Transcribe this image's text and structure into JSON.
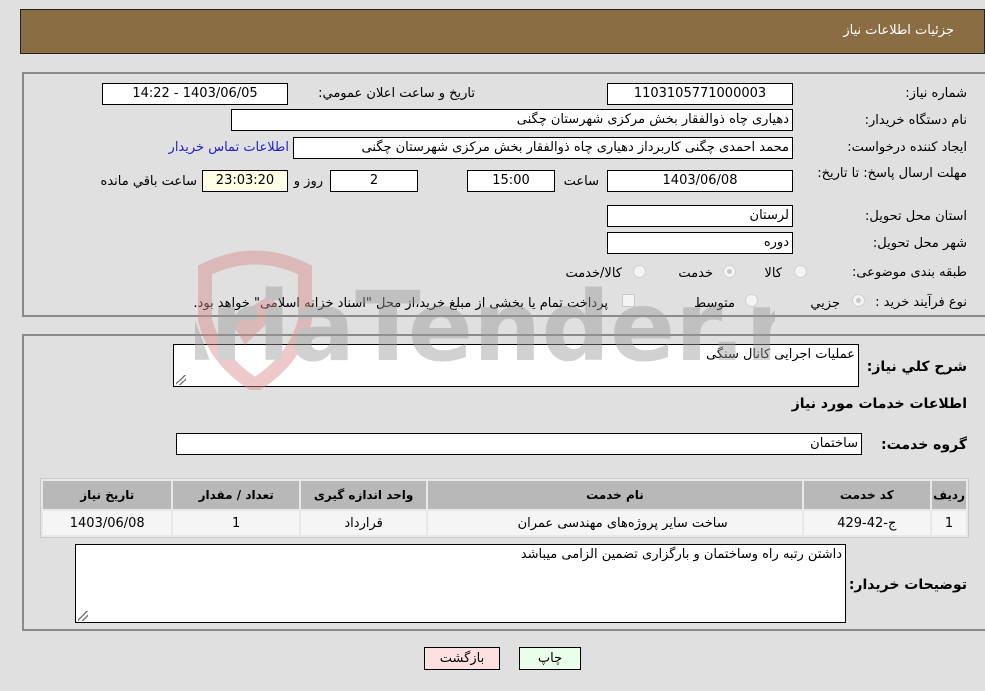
{
  "header": {
    "title": "جزئیات اطلاعات نیاز"
  },
  "form": {
    "need_number": {
      "label": "شماره نیاز:",
      "value": "1103105771000003"
    },
    "announce_datetime": {
      "label": "تاریخ و ساعت اعلان عمومي:",
      "value": "1403/06/05 - 14:22"
    },
    "buyer_org": {
      "label": "نام دستگاه خریدار:",
      "value": "دهیاری چاه ذوالفقار بخش مرکزی شهرستان چگنی"
    },
    "requester": {
      "label": "ایجاد کننده درخواست:",
      "value": "محمد احمدی چگنی کاربرداز دهیاری چاه ذوالفقار بخش مرکزی شهرستان چگنی"
    },
    "contact_link": "اطلاعات تماس خریدار",
    "deadline": {
      "label": "مهلت ارسال پاسخ: تا تاریخ:",
      "date": "1403/06/08",
      "time_label": "ساعت",
      "time": "15:00",
      "days": "2",
      "days_label": "روز و",
      "remaining": "23:03:20",
      "remaining_label": "ساعت باقي مانده"
    },
    "province": {
      "label": "استان محل تحویل:",
      "value": "لرستان"
    },
    "city": {
      "label": "شهر محل تحویل:",
      "value": "دوره"
    },
    "category": {
      "label": "طبقه بندی موضوعی:",
      "options": [
        "کالا",
        "خدمت",
        "کالا/خدمت"
      ],
      "selected": "خدمت"
    },
    "process_type": {
      "label": "نوع فرآیند خرید :",
      "options": [
        "جزيي",
        "متوسط"
      ],
      "selected": "جزيي",
      "treasury_note": "پرداخت تمام یا بخشی از مبلغ خرید،از محل \"اسناد خزانه اسلامی\" خواهد بود."
    }
  },
  "details": {
    "description_label": "شرح کلي نیاز:",
    "description": "عملیات اجرایی کانال سنگی",
    "services_title": "اطلاعات خدمات مورد نیاز",
    "service_group_label": "گروه خدمت:",
    "service_group": "ساختمان",
    "table": {
      "headers": [
        "ردیف",
        "کد خدمت",
        "نام خدمت",
        "واحد اندازه گیری",
        "تعداد / مقدار",
        "تاریخ نیاز"
      ],
      "rows": [
        [
          "1",
          "ج-42-429",
          "ساخت سایر پروژه‌های مهندسی عمران",
          "قرارداد",
          "1",
          "1403/06/08"
        ]
      ]
    },
    "buyer_notes_label": "توضیحات خریدار:",
    "buyer_notes": "داشتن رتبه راه وساختمان و بارگزاری تضمین الزامی میباشد"
  },
  "buttons": {
    "print": "چاپ",
    "back": "بازگشت"
  },
  "watermark": "AriaTender.neT",
  "colors": {
    "header_bg": "#8b6d43",
    "print_bg": "#eaffea",
    "back_bg": "#ffe0e0",
    "link": "#2222cc"
  }
}
